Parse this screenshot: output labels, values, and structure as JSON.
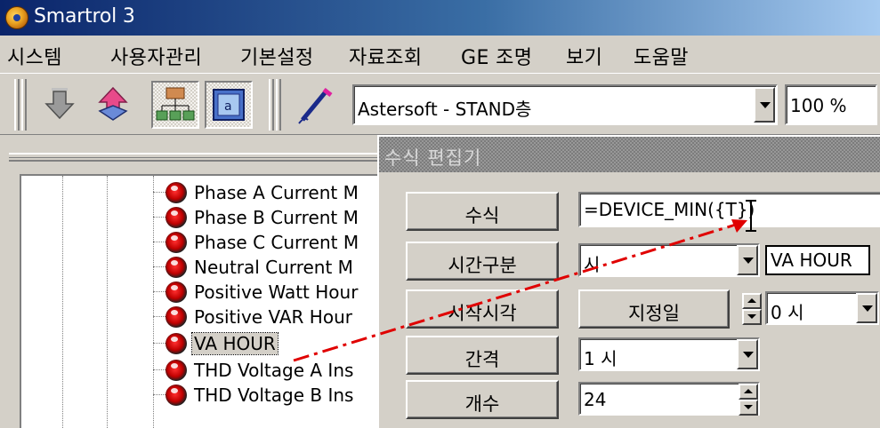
{
  "window": {
    "title": "Smartrol 3"
  },
  "menu": [
    "시스템",
    "사용자관리",
    "기본설정",
    "자료조회",
    "GE 조명",
    "보기",
    "도움말"
  ],
  "toolbar": {
    "icons": [
      "download-icon",
      "upload-icon",
      "network-tree-icon",
      "window-view-icon",
      "pen-icon"
    ],
    "site_combo": "Astersoft - STAND층",
    "zoom_combo": "100 %"
  },
  "tree": {
    "items": [
      "Phase A Current M",
      "Phase B Current M",
      "Phase C Current M",
      "Neutral Current M",
      "Positive Watt Hour",
      "Positive VAR Hour",
      "VA HOUR",
      "THD Voltage A Ins",
      "THD Voltage B Ins"
    ],
    "selected": "VA HOUR"
  },
  "dialog": {
    "title": "수식 편집기",
    "labels": {
      "formula": "수식",
      "time_division": "시간구분",
      "start_time": "시작시각",
      "interval": "간격",
      "count": "개수"
    },
    "formula_value": "=DEVICE_MIN({T})",
    "time_division_value": "시",
    "target_value": "VA HOUR",
    "start_button": "지정일",
    "start_hour_value": "0 시",
    "interval_value": "1 시",
    "count_value": "24"
  },
  "colors": {
    "titlebar_start": "#0a246a",
    "titlebar_end": "#a6caf0",
    "annotation_arrow": "#e00000"
  }
}
